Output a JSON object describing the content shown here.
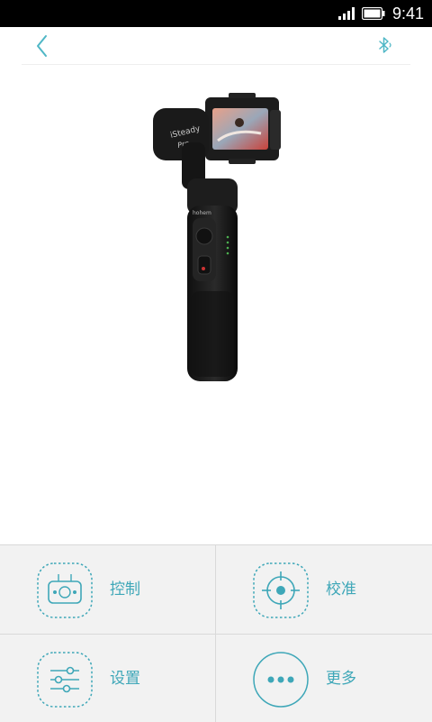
{
  "status_bar": {
    "time": "9:41"
  },
  "nav": {
    "back_icon": "chevron-left-icon",
    "bluetooth_icon": "bluetooth-icon"
  },
  "product": {
    "brand_text": "iSteady Pro"
  },
  "menu": {
    "items": [
      {
        "label": "控制",
        "icon": "gamepad-icon"
      },
      {
        "label": "校准",
        "icon": "crosshair-icon"
      },
      {
        "label": "设置",
        "icon": "sliders-icon"
      },
      {
        "label": "更多",
        "icon": "more-dots-icon"
      }
    ]
  },
  "colors": {
    "accent": "#3ea7b8",
    "grid_bg": "#f2f2f2",
    "divider": "#d9d9d9"
  }
}
